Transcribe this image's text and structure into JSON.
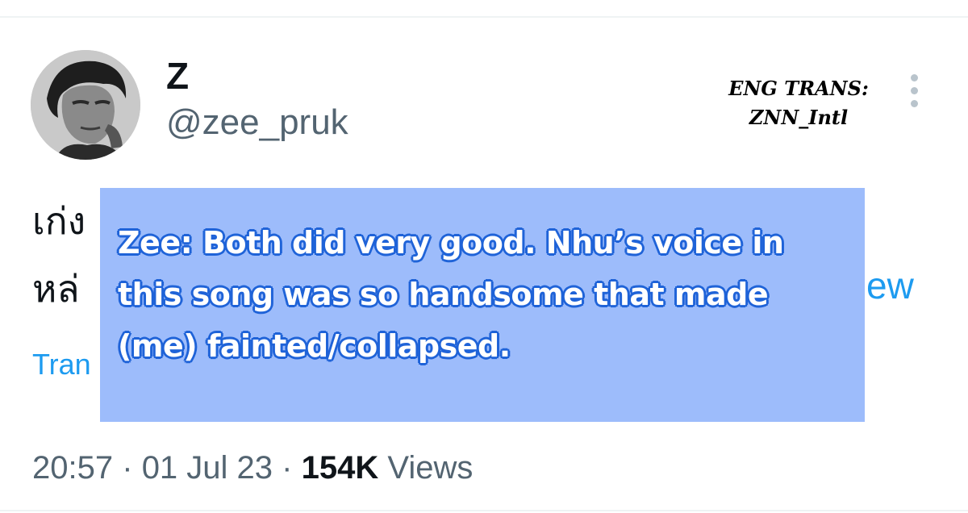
{
  "tweet": {
    "author": {
      "display_name": "Z",
      "handle": "@zee_pruk",
      "avatar_icon": "profile-photo"
    },
    "more_icon": "more-vertical-icon",
    "text_line_1": "เก่ง",
    "text_line_2": "หล่",
    "text_line_2_tail": "ew",
    "translate_label": "Tran",
    "meta": {
      "time": "20:57",
      "separator": "·",
      "date": "01 Jul 23",
      "views_count": "154K",
      "views_label": "Views"
    }
  },
  "overlay": {
    "credit_line_1": "ENG TRANS:",
    "credit_line_2": "ZNN_Intl",
    "translation_lines": [
      "Zee: Both did very good. Nhu’s voice in",
      "this song was so handsome that made",
      "(me) fainted/collapsed."
    ],
    "box_color": "#9dbcfb",
    "text_outline_color": "#1f63d8"
  },
  "colors": {
    "primary_text": "#0f1419",
    "secondary_text": "#536471",
    "link": "#1d9bf0"
  }
}
